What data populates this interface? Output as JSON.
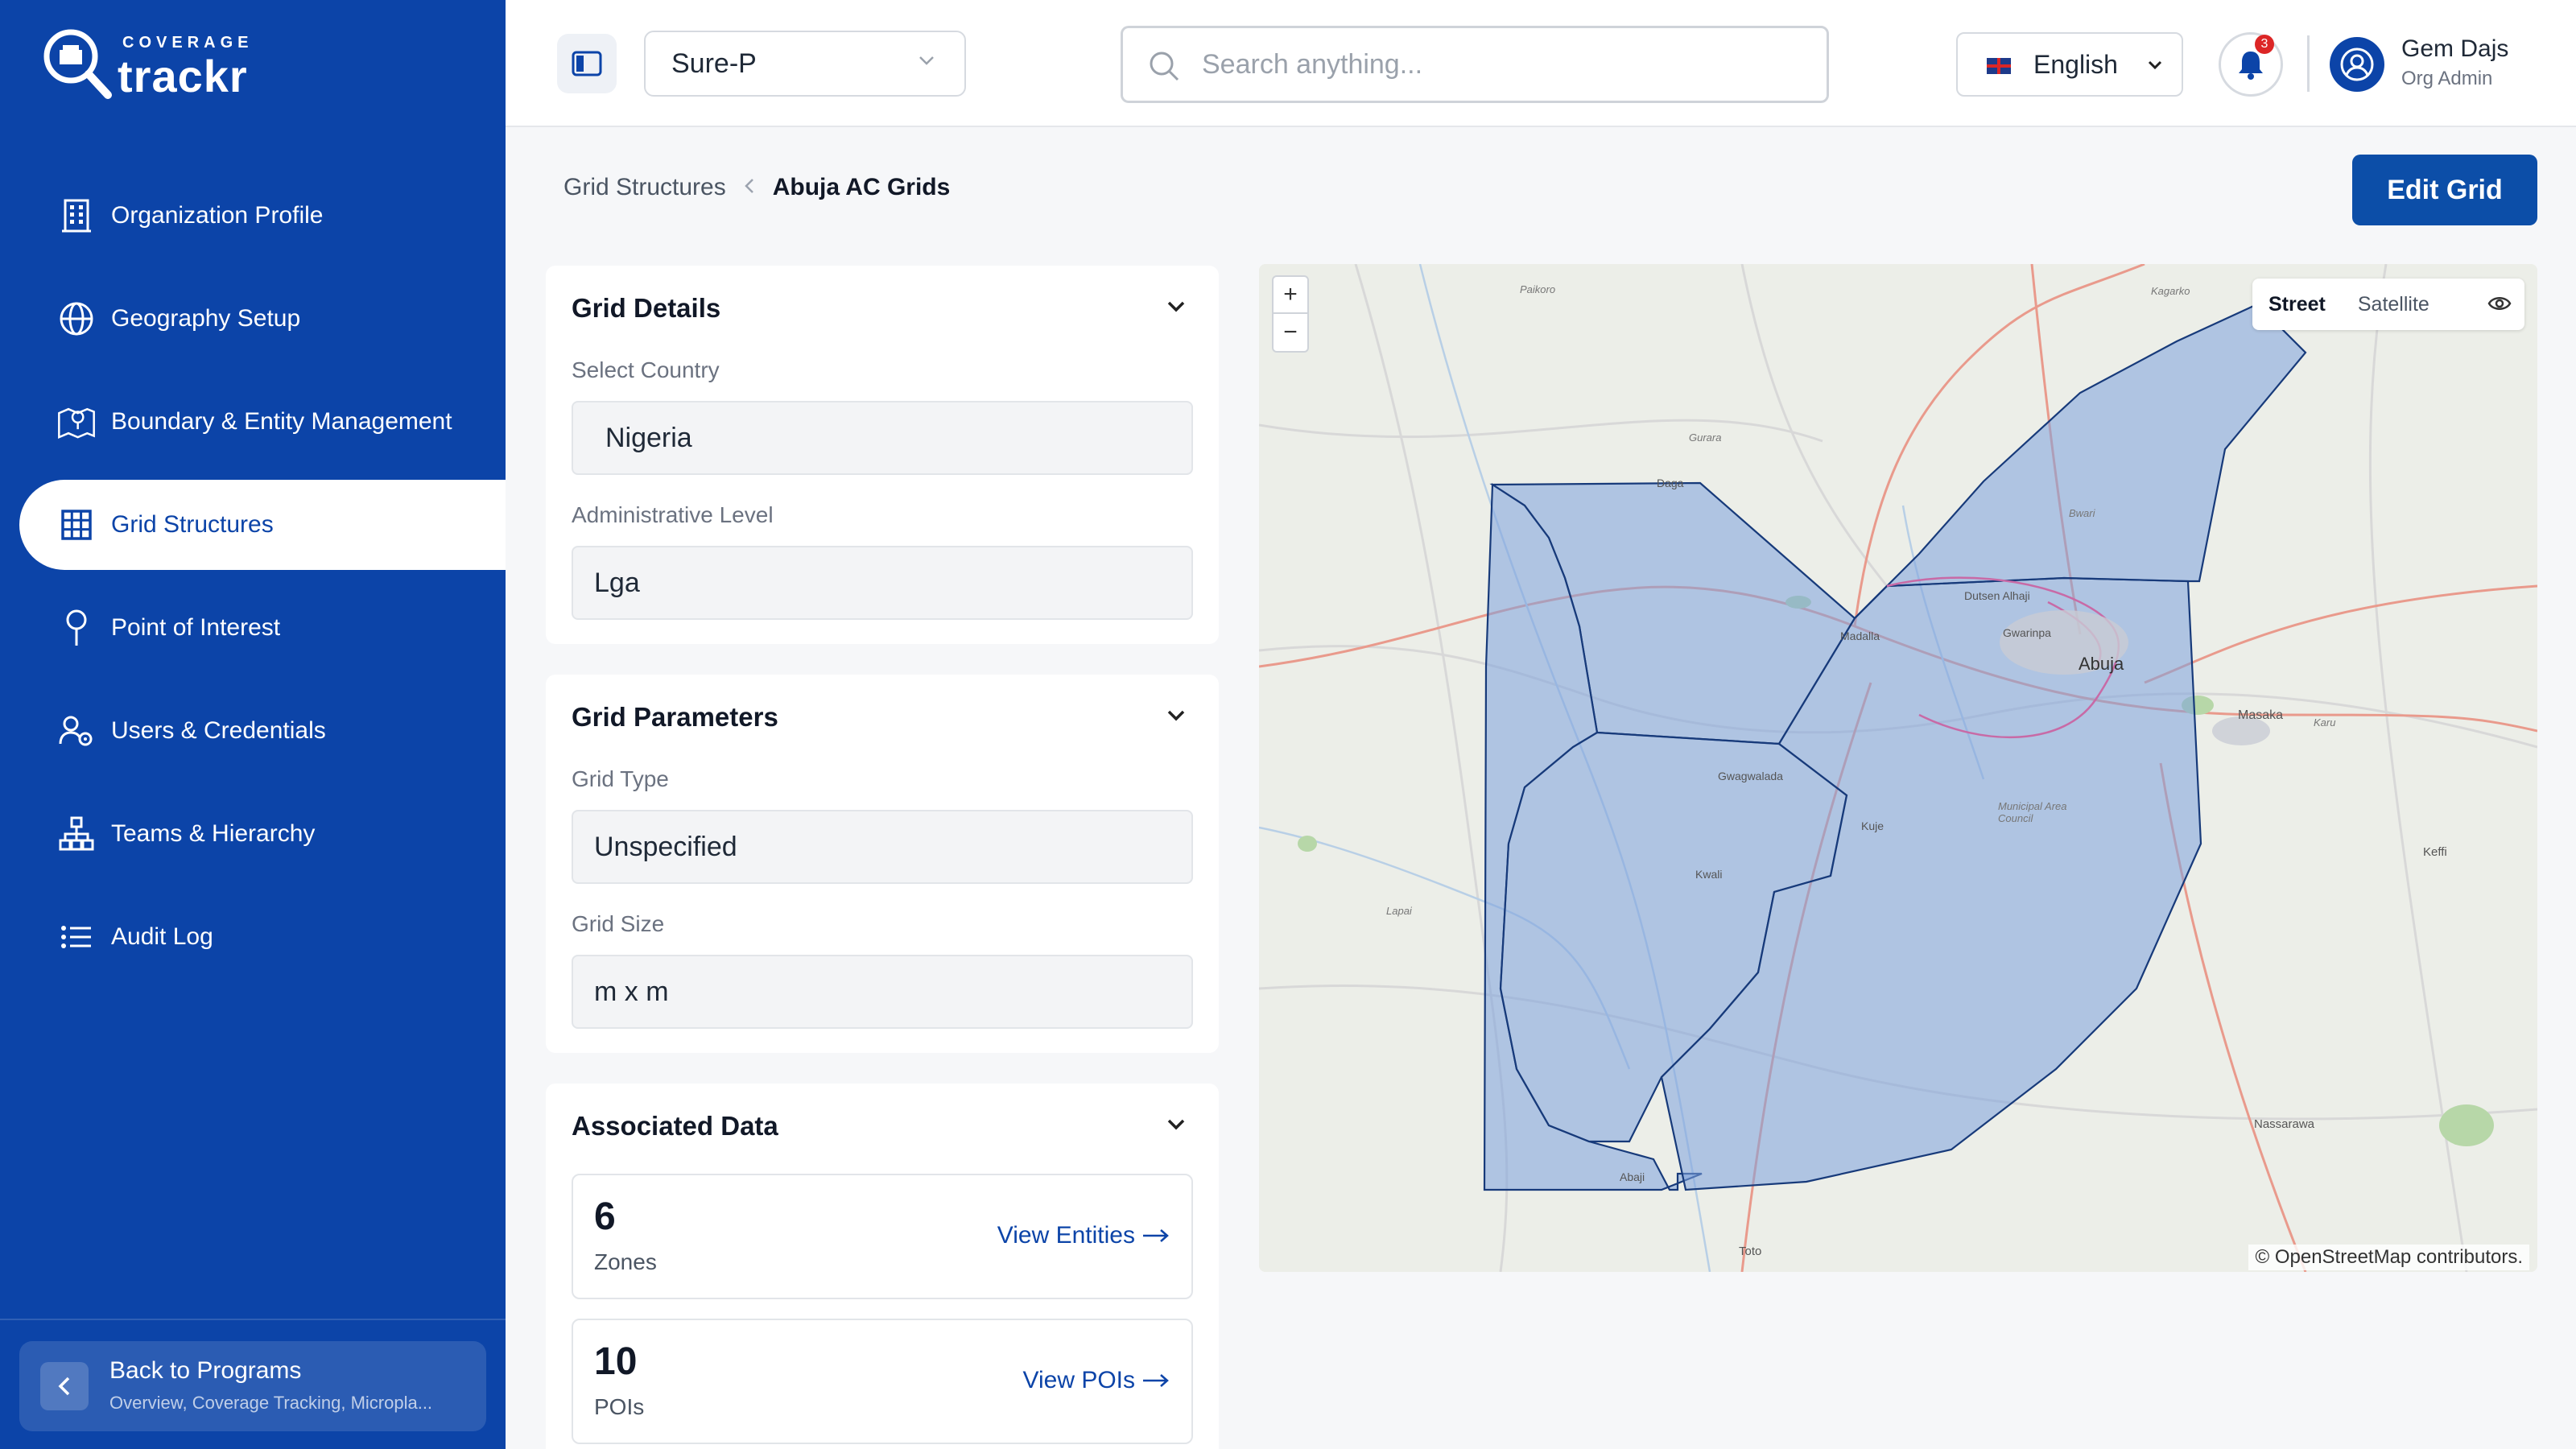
{
  "brand": {
    "small": "COVERAGE",
    "big": "trackr"
  },
  "sidebar": {
    "items": [
      {
        "label": "Organization Profile",
        "icon": "building-icon"
      },
      {
        "label": "Geography Setup",
        "icon": "globe-icon"
      },
      {
        "label": "Boundary & Entity Management",
        "icon": "map-pin-icon"
      },
      {
        "label": "Grid Structures",
        "icon": "grid-icon",
        "active": true
      },
      {
        "label": "Point of Interest",
        "icon": "location-pin-icon"
      },
      {
        "label": "Users & Credentials",
        "icon": "users-icon"
      },
      {
        "label": "Teams & Hierarchy",
        "icon": "hierarchy-icon"
      },
      {
        "label": "Audit Log",
        "icon": "list-icon"
      }
    ],
    "back": {
      "title": "Back to Programs",
      "subtitle": "Overview, Coverage Tracking, Micropla..."
    }
  },
  "header": {
    "program": "Sure-P",
    "search_placeholder": "Search anything...",
    "language": "English",
    "notifications": "3",
    "user_name": "Gem Dajs",
    "user_role": "Org Admin"
  },
  "breadcrumb": {
    "parent": "Grid Structures",
    "current": "Abuja AC Grids"
  },
  "edit_button": "Edit Grid",
  "grid_details": {
    "title": "Grid Details",
    "country_label": "Select Country",
    "country_value": "Nigeria",
    "level_label": "Administrative Level",
    "level_value": "Lga"
  },
  "grid_parameters": {
    "title": "Grid Parameters",
    "type_label": "Grid Type",
    "type_value": "Unspecified",
    "size_label": "Grid Size",
    "size_value": "m x m"
  },
  "associated": {
    "title": "Associated Data",
    "zones_count": "6",
    "zones_label": "Zones",
    "zones_link": "View Entities",
    "pois_count": "10",
    "pois_label": "POIs",
    "pois_link": "View POIs"
  },
  "map": {
    "zoom_in": "+",
    "zoom_out": "−",
    "street": "Street",
    "satellite": "Satellite",
    "attribution": "© OpenStreetMap contributors.",
    "places": {
      "abuja": "Abuja",
      "masaka": "Masaka",
      "keffi": "Keffi",
      "nassarawa": "Nassarawa",
      "toto": "Toto",
      "abaji": "Abaji",
      "kwali": "Kwali",
      "kuje": "Kuje",
      "dutsen_alhaji": "Dutsen Alhaji",
      "gwarinpa": "Gwarinpa",
      "madalla": "Madalla",
      "dagwa": "Daga",
      "gwagwalada": "Gwagwalada",
      "lapai": "Lapai",
      "paikoro": "Paikoro",
      "kagarko": "Kagarko",
      "gurara": "Gurara",
      "bwari": "Bwari",
      "karu": "Karu",
      "municipal": "Municipal Area Council"
    }
  }
}
